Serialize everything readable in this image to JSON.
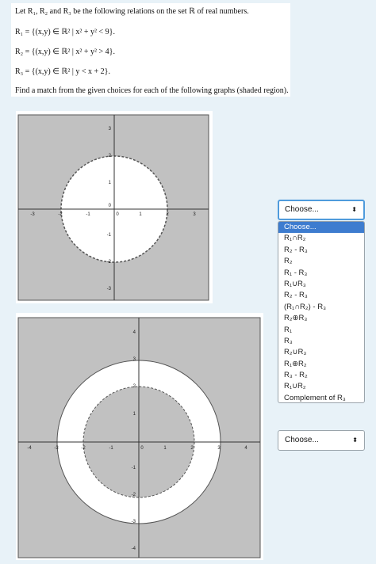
{
  "question": {
    "intro": "Let R₁, R₂ and R₃ be the following relations on the set ℝ of real numbers.",
    "r1": "R₁ = {(x,y) ∈ ℝ² | x² + y² < 9}.",
    "r2": "R₂ = {(x,y) ∈ ℝ² | x² + y² > 4}.",
    "r3": "R₃ = {(x,y) ∈ ℝ² | y < x + 2}.",
    "instruction": "Find a match from the given choices for each of the following graphs (shaded region)."
  },
  "graph1": {
    "x_ticks": [
      "-3",
      "-2",
      "-1",
      "0",
      "1",
      "2",
      "3"
    ],
    "y_ticks": [
      "3",
      "2",
      "1",
      "0",
      "-1",
      "-2",
      "-3"
    ]
  },
  "graph2": {
    "x_ticks": [
      "-4",
      "-3",
      "-2",
      "-1",
      "0",
      "1",
      "2",
      "3",
      "4"
    ],
    "y_ticks": [
      "4",
      "3",
      "2",
      "1",
      "-1",
      "-2",
      "-3",
      "-4"
    ]
  },
  "select1": {
    "value": "Choose...",
    "open": true
  },
  "select2": {
    "value": "Choose..."
  },
  "options": [
    "Choose...",
    "R₁∩R₂",
    "R₂ - R₃",
    "R₂",
    "R₁ - R₃",
    "R₁∪R₃",
    "R₂ - R₃",
    "(R₁∩R₂) - R₃",
    "R₂⊕R₃",
    "R₁",
    "R₃",
    "R₂∪R₃",
    "R₁⊕R₂",
    "R₃ - R₂",
    "R₁∪R₂",
    "Complement of R₃"
  ],
  "colors": {
    "shade": "#c1c1c1",
    "select_focus": "#4f9bdc",
    "option_highlight": "#3d7ccf"
  }
}
